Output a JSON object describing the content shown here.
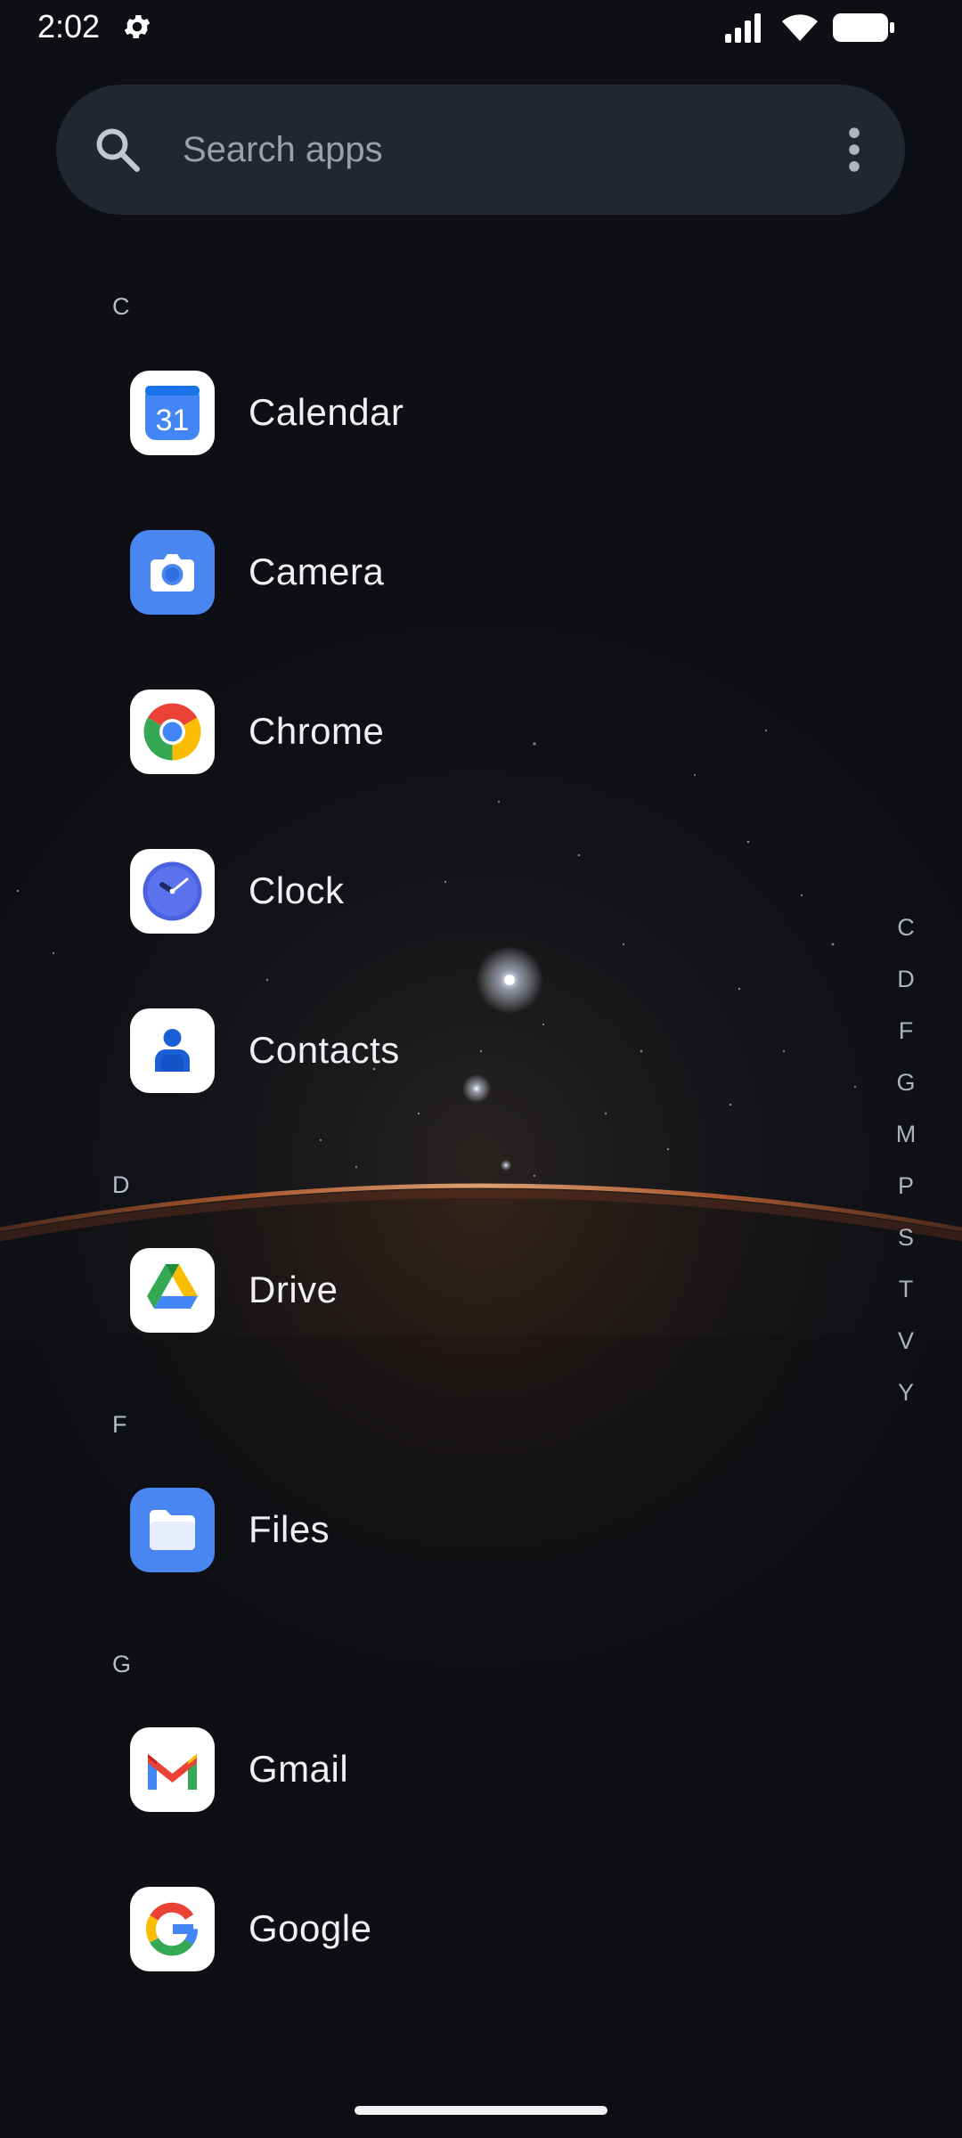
{
  "status_bar": {
    "time": "2:02",
    "icons": [
      "gear-icon",
      "signal-icon",
      "wifi-icon",
      "battery-icon"
    ]
  },
  "search": {
    "placeholder": "Search apps",
    "value": "",
    "icons": [
      "search-icon",
      "more-vert-icon"
    ]
  },
  "sections": [
    {
      "letter": "C",
      "apps": [
        {
          "label": "Calendar",
          "icon": "calendar-icon"
        },
        {
          "label": "Camera",
          "icon": "camera-icon"
        },
        {
          "label": "Chrome",
          "icon": "chrome-icon"
        },
        {
          "label": "Clock",
          "icon": "clock-icon"
        },
        {
          "label": "Contacts",
          "icon": "contacts-icon"
        }
      ]
    },
    {
      "letter": "D",
      "apps": [
        {
          "label": "Drive",
          "icon": "drive-icon"
        }
      ]
    },
    {
      "letter": "F",
      "apps": [
        {
          "label": "Files",
          "icon": "files-icon"
        }
      ]
    },
    {
      "letter": "G",
      "apps": [
        {
          "label": "Gmail",
          "icon": "gmail-icon"
        },
        {
          "label": "Google",
          "icon": "google-icon"
        }
      ]
    }
  ],
  "calendar_icon_text": "31",
  "fast_scroller": [
    "C",
    "D",
    "F",
    "G",
    "M",
    "P",
    "S",
    "T",
    "V",
    "Y"
  ],
  "colors": {
    "background": "#0d0f14",
    "search_bar": "#22262e",
    "text_primary": "#eef0f4",
    "text_secondary": "#b8bcc6",
    "google_blue": "#4285f4",
    "google_red": "#ea4335",
    "google_yellow": "#fbbc04",
    "google_green": "#34a853",
    "horizon_glow": "#c8602a"
  }
}
